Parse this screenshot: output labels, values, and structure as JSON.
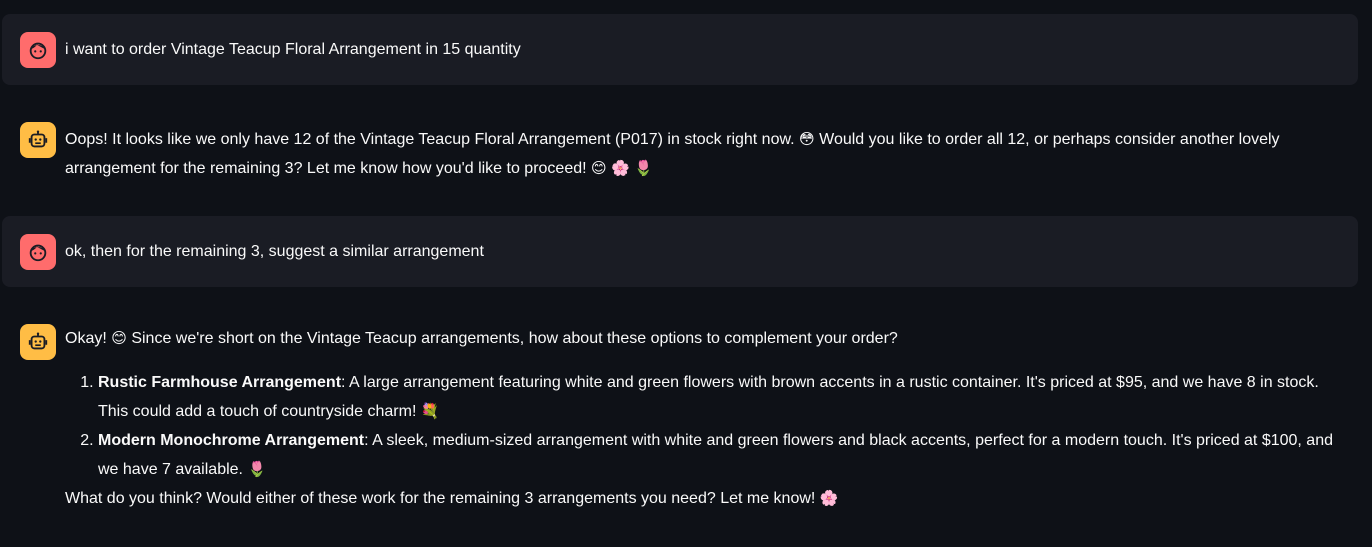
{
  "messages": [
    {
      "role": "user",
      "avatar_icon": "user-face-icon",
      "text": "i want to order Vintage Teacup Floral Arrangement in 15 quantity"
    },
    {
      "role": "assistant",
      "avatar_icon": "robot-face-icon",
      "text_a": "Oops! It looks like we only have 12 of the Vintage Teacup Floral Arrangement (P017) in stock right now. ",
      "emoji_a": "😳",
      "text_b": " Would you like to order all 12, or perhaps consider another lovely arrangement for the remaining 3? Let me know how you'd like to proceed! ",
      "emoji_b": "😊",
      "emoji_c": "🌸",
      "emoji_d": "🌷"
    },
    {
      "role": "user",
      "avatar_icon": "user-face-icon",
      "text": "ok, then for the remaining 3, suggest a similar arrangement"
    },
    {
      "role": "assistant",
      "avatar_icon": "robot-face-icon",
      "intro_a": "Okay! ",
      "intro_emoji": "😊",
      "intro_b": " Since we're short on the Vintage Teacup arrangements, how about these options to complement your order?",
      "options": [
        {
          "name": "Rustic Farmhouse Arrangement",
          "description": ": A large arrangement featuring white and green flowers with brown accents in a rustic container. It's priced at $95, and we have 8 in stock. This could add a touch of countryside charm! ",
          "emoji": "💐"
        },
        {
          "name": "Modern Monochrome Arrangement",
          "description": ": A sleek, medium-sized arrangement with white and green flowers and black accents, perfect for a modern touch. It's priced at $100, and we have 7 available. ",
          "emoji": "🌷"
        }
      ],
      "closing": "What do you think? Would either of these work for the remaining 3 arrangements you need? Let me know! ",
      "closing_emoji": "🌸"
    }
  ],
  "colors": {
    "background": "#0e1117",
    "user_bubble": "#1a1c24",
    "user_avatar": "#ff6c6c",
    "assistant_avatar": "#ffbd45",
    "text": "#fafafa"
  }
}
